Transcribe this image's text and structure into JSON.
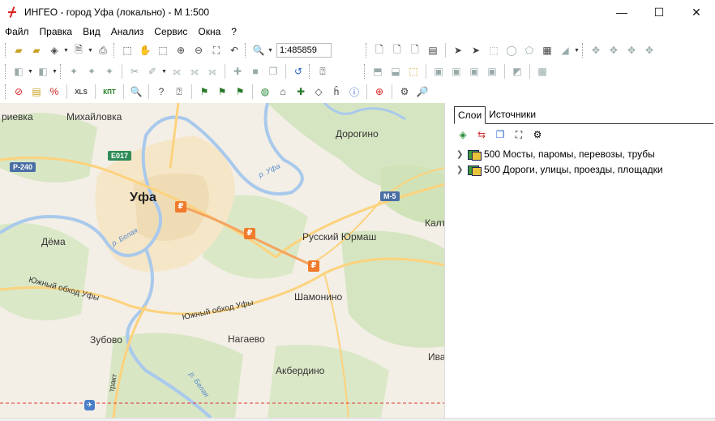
{
  "window": {
    "title": "ИНГЕО - город Уфа (локально) - М 1:500",
    "minimize": "—",
    "maximize": "☐",
    "close": "✕"
  },
  "menu": [
    "Файл",
    "Правка",
    "Вид",
    "Анализ",
    "Сервис",
    "Окна",
    "?"
  ],
  "toolbar": {
    "scale_value": "1:485859",
    "xls_label": "XLS",
    "kpt_label": "КПТ"
  },
  "map": {
    "labels": {
      "ufa": "Уфа",
      "mikhaylovka": "Михайловка",
      "rievka": "риевка",
      "dorogino": "Дорогино",
      "dema": "Дёма",
      "russky_yurmash": "Русский Юрмаш",
      "kalt": "Калт",
      "shamonino": "Шамонино",
      "yuzhny1": "Южный обход Уфы",
      "yuzhny2": "Южный обход Уфы",
      "zubovo": "Зубово",
      "nagaevo": "Нагаево",
      "ivan": "Ива",
      "akberdino": "Акбердино",
      "trakt": "тракт",
      "river_belaya1": "р. Белая",
      "river_belaya2": "р. Белая",
      "river_ufa": "р. Уфа"
    },
    "shields": {
      "r240": "Р-240",
      "e017": "E017",
      "m5": "М-5"
    },
    "toll_symbol": "₽"
  },
  "panel": {
    "tabs": [
      "Слои",
      "Источники"
    ],
    "active_tab": "Слои",
    "layers": [
      "500 Мосты, паромы, перевозы, трубы",
      "500 Дороги, улицы, проезды, площадки"
    ]
  }
}
